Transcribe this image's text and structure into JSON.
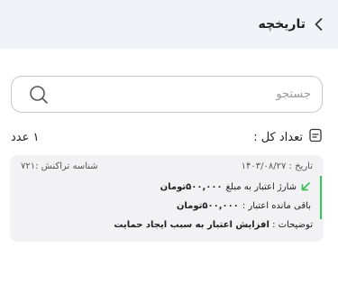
{
  "header": {
    "title": "تاریخچه"
  },
  "search": {
    "placeholder": "جستجو"
  },
  "summary": {
    "count_label": "تعداد کل :",
    "count_value": "۱ عدد"
  },
  "transaction": {
    "date_text": "تاریخ : ۱۴۰۳/۰۸/۲۷",
    "id_text": "شناسه تراکنش :۷۲۱",
    "charge_prefix": "شارژ اعتبار به مبلغ",
    "charge_amount": "۵۰۰,۰۰۰تومان",
    "remain_prefix": "باقی مانده اعتبار :",
    "remain_amount": "۵۰۰,۰۰۰تومان",
    "desc_prefix": "توضیحات :",
    "desc_value": "افزایش اعتبار به سبب ایجاد حمایت"
  },
  "colors": {
    "header_bg": "#f2f3f8",
    "card_bg": "#f2f2f4",
    "accent_green": "#3ec05a"
  },
  "icons": {
    "back": "chevron-right-icon",
    "search": "search-icon",
    "document": "document-icon",
    "arrow": "arrow-down-left-icon"
  }
}
